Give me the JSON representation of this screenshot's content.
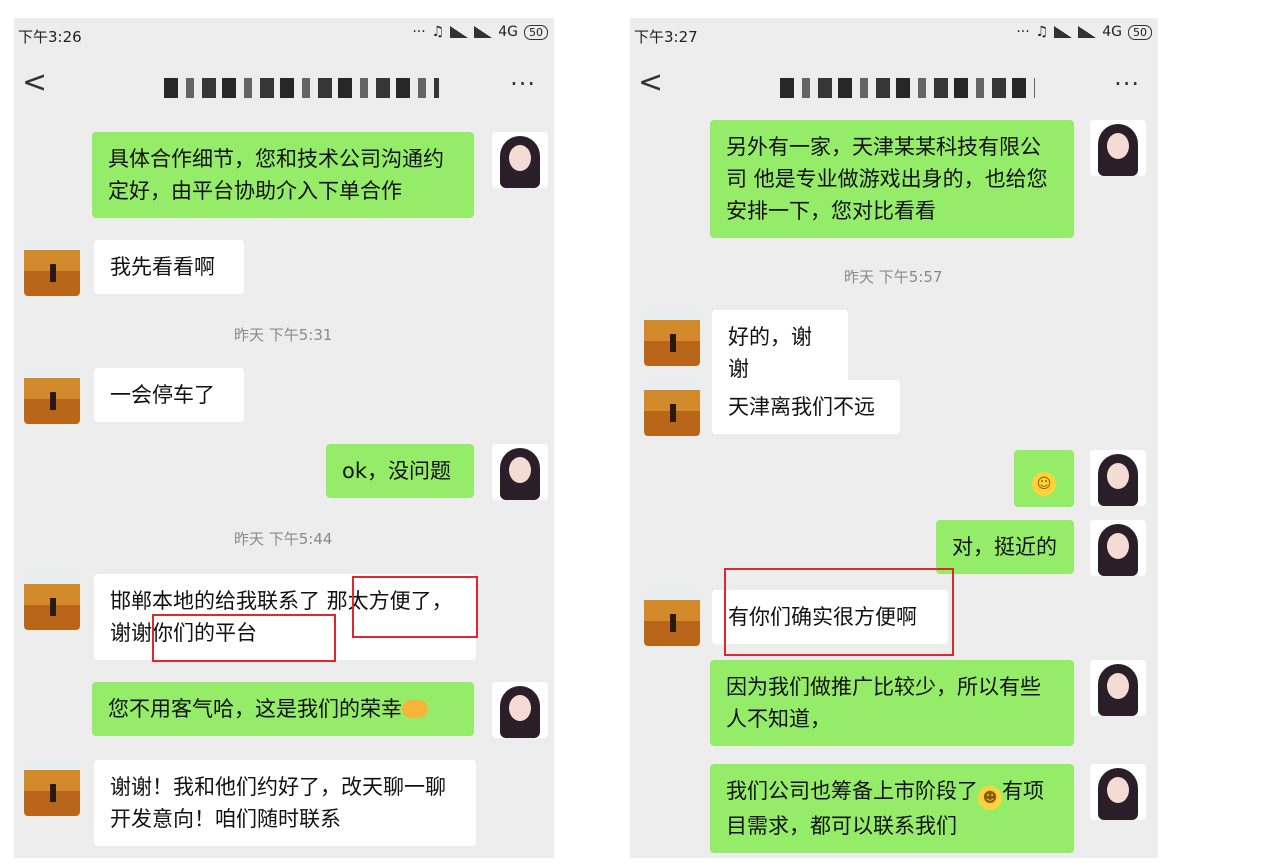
{
  "left": {
    "status_time": "下午3:26",
    "network": "4G",
    "battery": "50",
    "back_label": "<",
    "more_label": "···",
    "messages": [
      {
        "text": "具体合作细节，您和技术公司沟通约定好，由平台协助介入下单合作"
      },
      {
        "text": "我先看看啊"
      },
      {
        "text": "一会停车了"
      },
      {
        "text": "ok，没问题"
      },
      {
        "text": "邯郸本地的给我联系了 那太方便了，谢谢你们的平台"
      },
      {
        "text": "您不用客气哈，这是我们的荣幸"
      },
      {
        "text": "谢谢！我和他们约好了，改天聊一聊开发意向！咱们随时联系"
      }
    ],
    "timestamps": [
      "昨天 下午5:31",
      "昨天 下午5:44"
    ]
  },
  "right": {
    "status_time": "下午3:27",
    "network": "4G",
    "battery": "50",
    "back_label": "<",
    "more_label": "···",
    "messages": [
      {
        "text": "另外有一家，天津某某科技有限公司 他是专业做游戏出身的，也给您安排一下，您对比看看"
      },
      {
        "text": "好的，谢谢"
      },
      {
        "text": "天津离我们不远"
      },
      {
        "text": "☺"
      },
      {
        "text": "对，挺近的"
      },
      {
        "text": "有你们确实很方便啊"
      },
      {
        "text": "因为我们做推广比较少，所以有些人不知道，"
      },
      {
        "text": "我们公司也筹备上市阶段了"
      },
      {
        "text": "有项目需求，都可以联系我们"
      }
    ],
    "timestamps": [
      "昨天 下午5:57"
    ]
  },
  "colors": {
    "sent_bubble": "#95ec69",
    "received_bubble": "#ffffff",
    "chat_bg": "#ededed",
    "highlight": "#e0262f"
  }
}
